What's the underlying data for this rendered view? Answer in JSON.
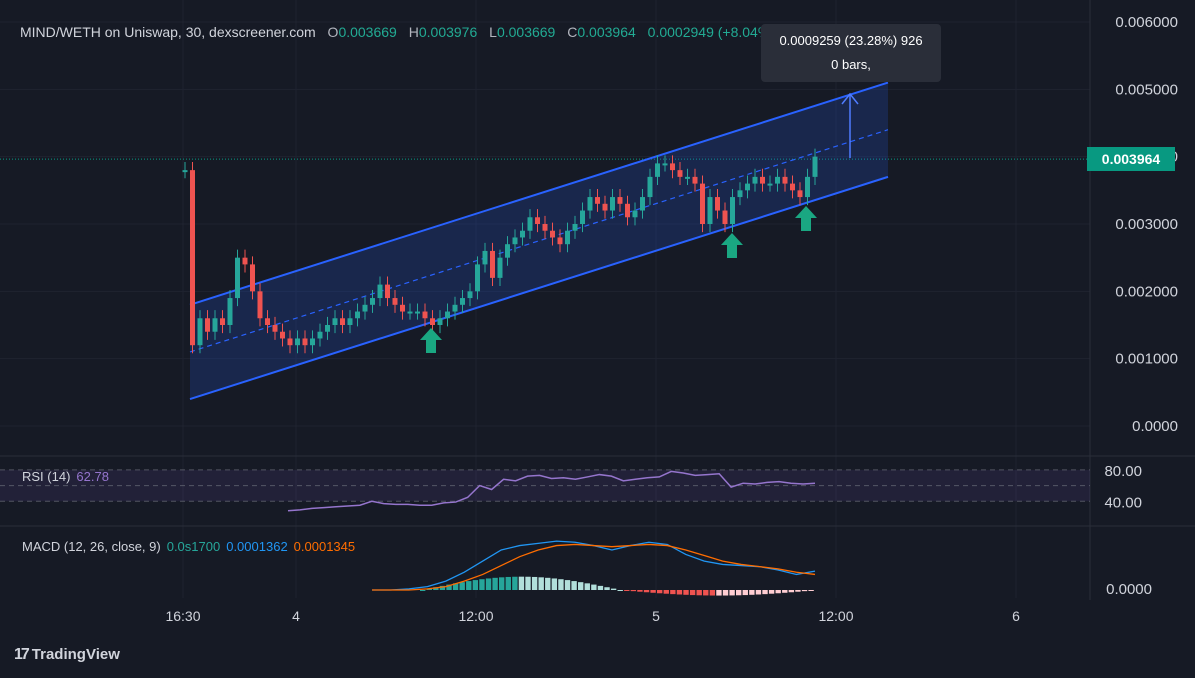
{
  "header": {
    "symbol": "MIND/WETH on Uniswap, 30, dexscreener.com",
    "o_key": "O",
    "o_val": "0.003669",
    "h_key": "H",
    "h_val": "0.003976",
    "l_key": "L",
    "l_val": "0.003669",
    "c_key": "C",
    "c_val": "0.003964",
    "change": "0.0002949 (+8.04%)"
  },
  "tooltip": {
    "line1": "0.0009259 (23.28%) 926",
    "line2": "0 bars,"
  },
  "current_price_label": "0.003964",
  "rsi": {
    "label": "RSI (14)",
    "value": "62.78",
    "ticks": [
      "80.00",
      "40.00"
    ]
  },
  "macd": {
    "label": "MACD (12, 26, close, 9)",
    "hist": "0.0s1700",
    "macd": "0.0001362",
    "signal": "0.0001345",
    "tick": "0.0000"
  },
  "branding": {
    "name": "TradingView",
    "mark": "17"
  },
  "colors": {
    "up": "#26a69a",
    "down": "#ef5350",
    "channel": "#2962ff",
    "rsi": "#9575cd",
    "macd": "#2196f3",
    "signal": "#ff6d00"
  },
  "chart_data": {
    "type": "candlestick",
    "y_ticks": [
      "0.006000",
      "0.005000",
      "0.004000",
      "0.003000",
      "0.002000",
      "0.001000",
      "0.0000"
    ],
    "ylim": [
      0,
      0.006
    ],
    "x_ticks": [
      "16:30",
      "4",
      "12:00",
      "5",
      "12:00",
      "6"
    ],
    "close": [
      0.0038,
      0.0012,
      0.0016,
      0.0014,
      0.0016,
      0.0015,
      0.0019,
      0.0025,
      0.0024,
      0.002,
      0.0016,
      0.0015,
      0.0014,
      0.0013,
      0.0012,
      0.0013,
      0.0012,
      0.0013,
      0.0014,
      0.0015,
      0.0016,
      0.0015,
      0.0016,
      0.0017,
      0.0018,
      0.0019,
      0.0021,
      0.0019,
      0.0018,
      0.0017,
      0.0017,
      0.0017,
      0.0016,
      0.0015,
      0.0016,
      0.0017,
      0.0018,
      0.0019,
      0.002,
      0.0024,
      0.0026,
      0.0022,
      0.0025,
      0.0027,
      0.0028,
      0.0029,
      0.0031,
      0.003,
      0.0029,
      0.0028,
      0.0027,
      0.0029,
      0.003,
      0.0032,
      0.0034,
      0.0033,
      0.0032,
      0.0034,
      0.0033,
      0.0031,
      0.0032,
      0.0034,
      0.0037,
      0.0039,
      0.0039,
      0.0038,
      0.0037,
      0.0037,
      0.0036,
      0.003,
      0.0034,
      0.0032,
      0.003,
      0.0034,
      0.0035,
      0.0036,
      0.0037,
      0.0036,
      0.0036,
      0.0037,
      0.0036,
      0.0035,
      0.0034,
      0.0037,
      0.004
    ],
    "rsi_values": [
      28,
      29,
      31,
      32,
      33,
      34,
      35,
      40,
      37,
      36,
      36,
      35,
      35,
      38,
      39,
      45,
      60,
      55,
      68,
      66,
      72,
      73,
      69,
      70,
      68,
      71,
      74,
      72,
      66,
      68,
      70,
      71,
      78,
      76,
      73,
      74,
      75,
      58,
      63,
      62,
      64,
      65,
      63,
      62,
      63
    ],
    "macd_line": [
      0,
      0,
      1e-05,
      3e-05,
      8e-05,
      0.00016,
      0.00026,
      0.00036,
      0.0004,
      0.00042,
      0.00044,
      0.00043,
      0.0004,
      0.00036,
      0.0004,
      0.00043,
      0.00041,
      0.00032,
      0.00026,
      0.00023,
      0.00022,
      0.00021,
      0.00018,
      0.00014,
      0.00017
    ],
    "signal_line": [
      0,
      0,
      0,
      1e-05,
      3e-05,
      8e-05,
      0.00014,
      0.00022,
      0.0003,
      0.00036,
      0.0004,
      0.00041,
      0.0004,
      0.00039,
      0.0004,
      0.00041,
      0.0004,
      0.00036,
      0.00031,
      0.00026,
      0.00023,
      0.00021,
      0.00019,
      0.00016,
      0.00014
    ],
    "channel": {
      "upper_start": 0.0018,
      "upper_end": 0.0051,
      "lower_start": 0.0004,
      "lower_end": 0.0037
    }
  }
}
